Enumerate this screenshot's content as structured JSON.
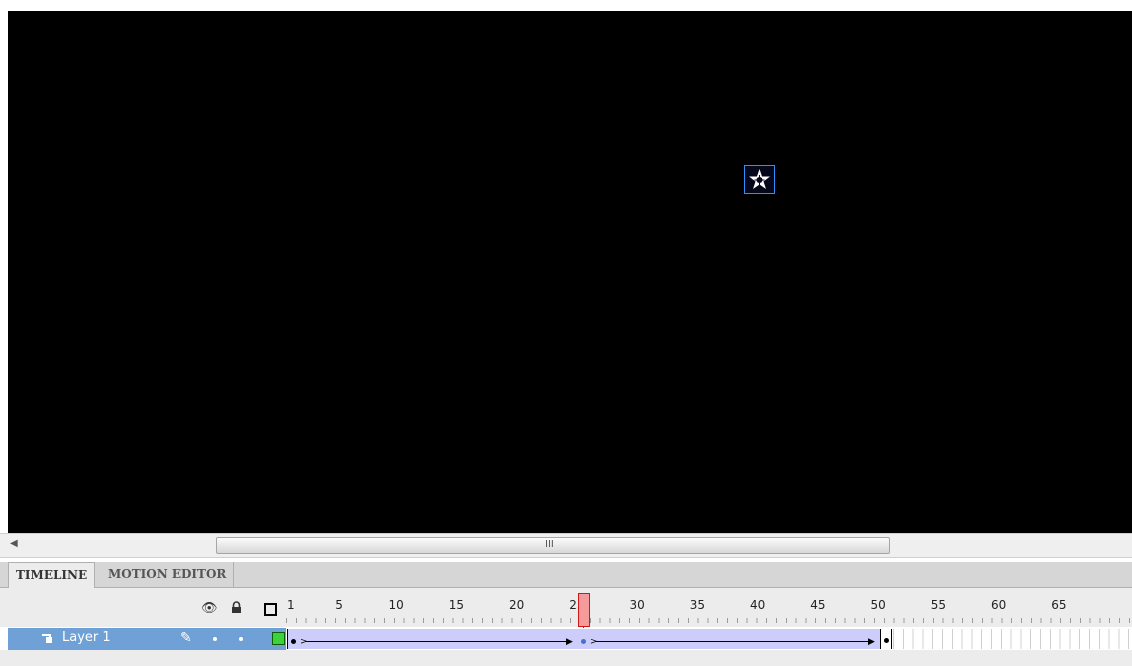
{
  "stage": {
    "background": "#000000",
    "selection_color": "#2f8fff",
    "symbol_icon": "pentagram-star-symbol"
  },
  "scrollbar": {
    "left_arrow_icon": "left-arrow-icon",
    "grip": "III"
  },
  "tabs": {
    "timeline": "TIMELINE",
    "motion_editor": "MOTION EDITOR"
  },
  "header": {
    "eye_icon": "eye-icon",
    "lock_icon": "lock-icon",
    "outline_icon": "outline-square-icon",
    "frame_numbers": [
      "1",
      "5",
      "10",
      "15",
      "20",
      "25",
      "30",
      "35",
      "40",
      "45",
      "50",
      "55",
      "60",
      "65"
    ],
    "current_frame": 24
  },
  "layer": {
    "name": "Layer 1",
    "color": "#3ad43a",
    "tween_color": "#cccdfa",
    "keyframes": [
      1,
      24,
      48
    ],
    "last_frame": 48
  }
}
